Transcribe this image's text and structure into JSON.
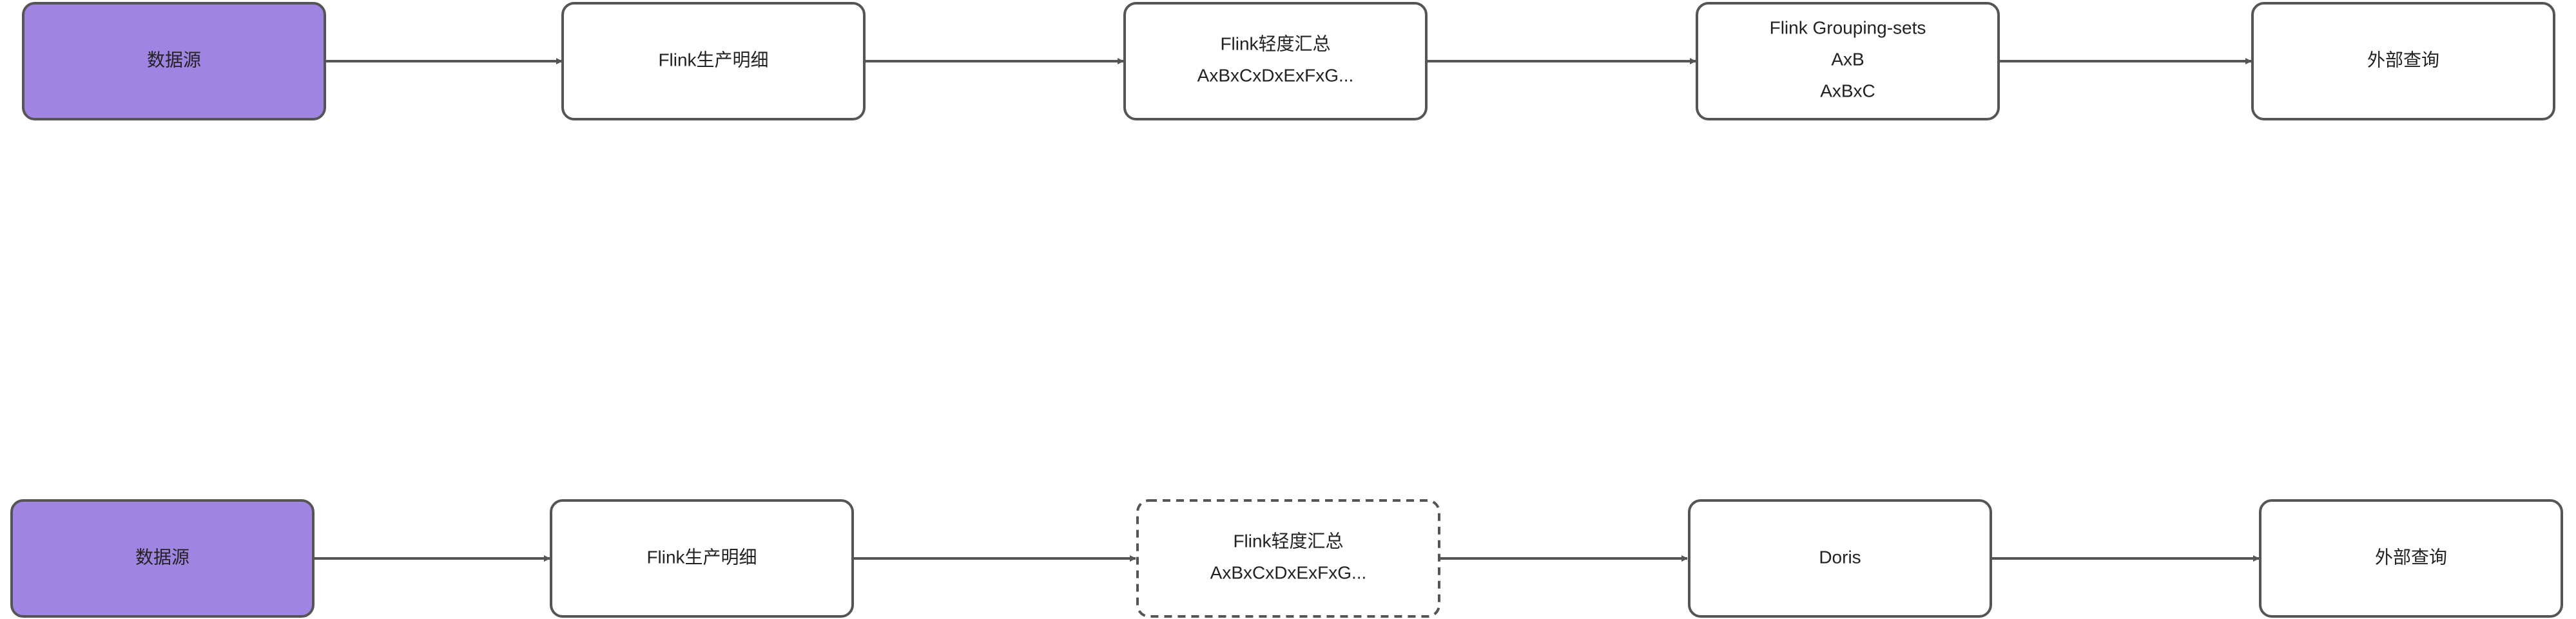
{
  "diagram": {
    "row1": {
      "source": "数据源",
      "detail": "Flink生产明细",
      "light_summary": [
        "Flink轻度汇总",
        "AxBxCxDxExFxG..."
      ],
      "grouping_sets": [
        "Flink Grouping-sets",
        "AxB",
        "AxBxC"
      ],
      "query": "外部查询"
    },
    "row2": {
      "source": "数据源",
      "detail": "Flink生产明细",
      "light_summary": [
        "Flink轻度汇总",
        "AxBxCxDxExFxG..."
      ],
      "doris": "Doris",
      "query": "外部查询"
    }
  },
  "colors": {
    "source_fill": "#a084e1",
    "stroke": "#555555",
    "box_fill": "#ffffff",
    "text": "#222222"
  }
}
